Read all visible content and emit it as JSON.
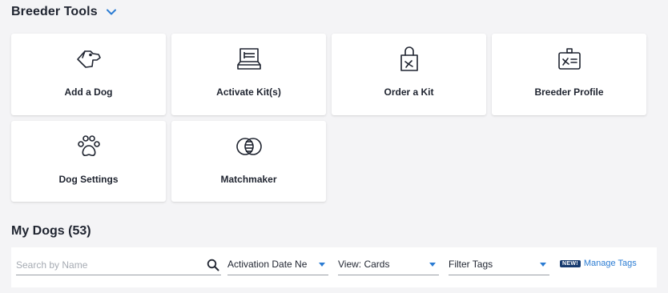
{
  "header": {
    "title": "Breeder Tools",
    "toggle_icon": "chevron-down-icon",
    "accent": "#2b7cd3"
  },
  "tools": [
    {
      "label": "Add a Dog",
      "icon": "dog-head-icon"
    },
    {
      "label": "Activate Kit(s)",
      "icon": "laptop-kit-icon"
    },
    {
      "label": "Order a Kit",
      "icon": "shopping-bag-icon"
    },
    {
      "label": "Breeder Profile",
      "icon": "id-badge-icon"
    },
    {
      "label": "Dog Settings",
      "icon": "paw-icon"
    },
    {
      "label": "Matchmaker",
      "icon": "overlap-circles-icon"
    }
  ],
  "my_dogs": {
    "title": "My Dogs (53)"
  },
  "filters": {
    "search_placeholder": "Search by Name",
    "sort_value": "Activation Date Ne",
    "view_value": "View: Cards",
    "tags_value": "Filter Tags",
    "new_badge": "NEW!",
    "manage_tags": "Manage Tags"
  }
}
